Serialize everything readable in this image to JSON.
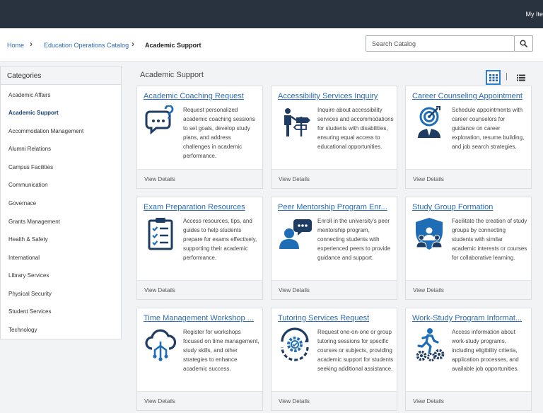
{
  "header": {
    "my_items": "My Ite"
  },
  "breadcrumb": {
    "home": "Home",
    "catalog": "Education Operations Catalog",
    "current": "Academic Support"
  },
  "search": {
    "placeholder": "Search Catalog"
  },
  "sidebar": {
    "heading": "Categories",
    "items": [
      {
        "label": "Academic Affairs",
        "active": false
      },
      {
        "label": "Academic Support",
        "active": true
      },
      {
        "label": "Accommodation Management",
        "active": false
      },
      {
        "label": "Alumni Relations",
        "active": false
      },
      {
        "label": "Campus Facilities",
        "active": false
      },
      {
        "label": "Communication",
        "active": false
      },
      {
        "label": "Governace",
        "active": false
      },
      {
        "label": "Grants Management",
        "active": false
      },
      {
        "label": "Health & Safety",
        "active": false
      },
      {
        "label": "International",
        "active": false
      },
      {
        "label": "Library Services",
        "active": false
      },
      {
        "label": "Physical Security",
        "active": false
      },
      {
        "label": "Student Services",
        "active": false
      },
      {
        "label": "Technology",
        "active": false
      }
    ]
  },
  "main": {
    "title": "Academic Support",
    "view_mode": "grid",
    "cards": [
      {
        "title": "Academic Coaching Request",
        "icon": "chat-question-icon",
        "description": "Request personalized academic coaching sessions to set goals, develop study plans, and address challenges in academic performance.",
        "footer": "View Details"
      },
      {
        "title": "Accessibility Services Inquiry",
        "icon": "accessibility-signpost-icon",
        "description": "Inquire about accessibility services and accommodations for students with disabilities, ensuring equal access to educational opportunities.",
        "footer": "View Details"
      },
      {
        "title": "Career Counseling Appointment",
        "icon": "career-target-icon",
        "description": "Schedule appointments with career counselors for guidance on career exploration, resume building, and job search strategies.",
        "footer": "View Details"
      },
      {
        "title": "Exam Preparation Resources",
        "icon": "checklist-clipboard-icon",
        "description": "Access resources, tips, and guides to help students prepare for exams effectively, supporting their academic performance.",
        "footer": "View Details"
      },
      {
        "title": "Peer Mentorship Program Enr...",
        "icon": "mentor-chat-icon",
        "description": "Enroll in the university's peer mentorship program, connecting students with experienced peers to provide guidance and support.",
        "footer": "View Details"
      },
      {
        "title": "Study Group Formation",
        "icon": "study-group-shield-icon",
        "description": "Facilitate the creation of study groups by connecting students with similar academic interests or courses for collaborative learning.",
        "footer": "View Details"
      },
      {
        "title": "Time Management Workshop ...",
        "icon": "cloud-network-icon",
        "description": "Register for workshops focused on time management, study skills, and other strategies to enhance academic success.",
        "footer": "View Details"
      },
      {
        "title": "Tutoring Services Request",
        "icon": "tutoring-gear-icon",
        "description": "Request one-on-one or group tutoring sessions for specific courses or subjects, providing academic support for students seeking additional assistance.",
        "footer": "View Details"
      },
      {
        "title": "Work-Study Program Informat...",
        "icon": "runner-gears-icon",
        "description": "Access information about work-study programs, including eligibility criteria, application processes, and available job opportunities.",
        "footer": "View Details"
      }
    ]
  },
  "colors": {
    "topbar": "#293340",
    "link": "#2b6bb6",
    "icon": "#1f3c63",
    "icon_accent": "#1f6db5",
    "active_view": "#2b7fd4"
  }
}
